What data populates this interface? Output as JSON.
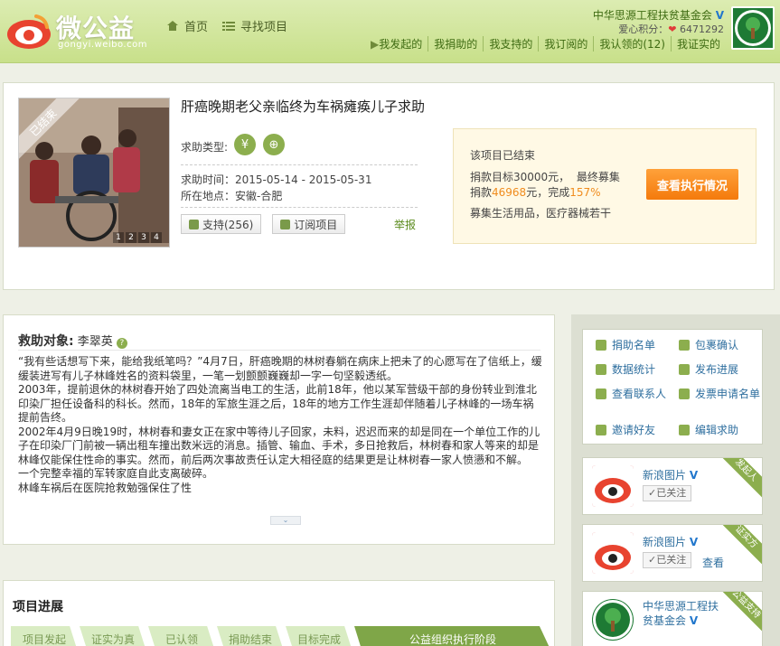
{
  "header": {
    "logo_text": "微公益",
    "logo_sub": "gongyi.weibo.com",
    "nav": [
      {
        "label": "首页",
        "icon": "home-icon"
      },
      {
        "label": "寻找项目",
        "icon": "list-icon"
      }
    ],
    "org_name": "中华思源工程扶贫基金会",
    "love_label": "爱心积分：",
    "love_value": "6471292",
    "subnav": [
      "我发起的",
      "我捐助的",
      "我支持的",
      "我订阅的",
      "我认领的(12)",
      "我证实的"
    ]
  },
  "project": {
    "ribbon": "已结束",
    "thumbs": [
      "1",
      "2",
      "3",
      "4"
    ],
    "title": "肝癌晚期老父亲临终为车祸瘫痪儿子求助",
    "help_type_label": "求助类型:",
    "help_icons": [
      {
        "glyph": "¥",
        "name": "money-icon"
      },
      {
        "glyph": "⊕",
        "name": "supplies-icon"
      }
    ],
    "time_label": "求助时间",
    "time_value": "：2015-05-14 - 2015-05-31",
    "place_label": "所在地点",
    "place_value": "：安徽-合肥",
    "support_label": "支持(256)",
    "subscribe_label": "订阅项目",
    "report_label": "举报",
    "status": {
      "ended": "该项目已结束",
      "goal_prefix": "捐款目标30000元，",
      "goal_suffix": "最终募集",
      "raised_prefix": "捐款",
      "raised_amount": "46968",
      "raised_mid": "元，完成",
      "raised_pct": "157%",
      "supplies": "募集生活用品，医疗器械若干",
      "view_button": "查看执行情况"
    }
  },
  "rescue": {
    "label": "救助对象:",
    "name": "李翠英",
    "qmark": "?",
    "paragraphs": [
      "“我有些话想写下来，能给我纸笔吗？”4月7日，肝癌晚期的林树春躺在病床上把未了的心愿写在了信纸上，缓缓装进写有儿子林峰姓名的资料袋里，一笔一划颤颤巍巍却一字一句坚毅透纸。",
      "2003年，提前退休的林树春开始了四处流离当电工的生活，此前18年，他以某军营级干部的身份转业到淮北印染厂担任设备科的科长。然而，18年的军旅生涯之后，18年的地方工作生涯却伴随着儿子林峰的一场车祸提前告终。",
      "2002年4月9日晚19时，林树春和妻女正在家中等待儿子回家，未料，迟迟而来的却是同在一个单位工作的儿子在印染厂门前被一辆出租车撞出数米远的消息。插管、输血、手术，多日抢救后，林树春和家人等来的却是林峰仅能保住性命的事实。然而，前后两次事故责任认定大相径庭的结果更是让林树春一家人愤懑和不解。",
      "一个完整幸福的军转家庭自此支离破碎。",
      "林峰车祸后在医院抢救勉强保住了性"
    ],
    "more": "⌄"
  },
  "progress": {
    "title": "项目进展",
    "steps": [
      "项目发起",
      "证实为真",
      "已认领",
      "捐助结束",
      "目标完成",
      "公益组织执行阶段"
    ]
  },
  "sidebar": {
    "actions": [
      {
        "label": "捐助名单",
        "icon": "donor-list-icon"
      },
      {
        "label": "包裹确认",
        "icon": "package-icon"
      },
      {
        "label": "数据统计",
        "icon": "stats-icon"
      },
      {
        "label": "发布进展",
        "icon": "publish-icon"
      },
      {
        "label": "查看联系人",
        "icon": "contacts-icon"
      },
      {
        "label": "发票申请名单",
        "icon": "invoice-icon"
      },
      {
        "label": "邀请好友",
        "icon": "invite-icon"
      },
      {
        "label": "编辑求助",
        "icon": "edit-icon"
      }
    ],
    "initiator": {
      "name": "新浪图片",
      "follow": "✓已关注",
      "corner": "发起人"
    },
    "verifier": {
      "name": "新浪图片",
      "follow": "✓已关注",
      "view": "查看",
      "corner": "证实方"
    },
    "org": {
      "name": "中华思源工程扶贫基金会",
      "corner": "公益支持"
    },
    "v_mark": "V"
  },
  "colors": {
    "brand_green": "#8cae4e",
    "accent_orange": "#f47a0c",
    "link_blue": "#2f6f9f"
  }
}
